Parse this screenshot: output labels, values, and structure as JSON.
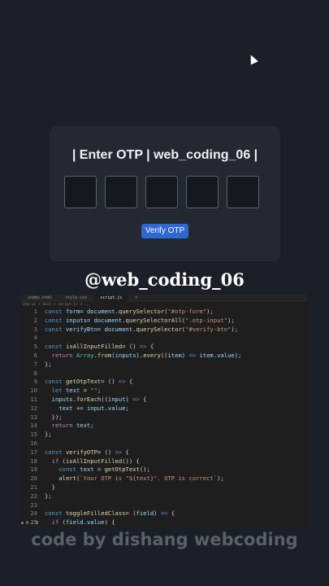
{
  "card": {
    "title": "| Enter OTP | web_coding_06 |",
    "otp_inputs": [
      "",
      "",
      "",
      "",
      ""
    ],
    "verify_label": "Verify OTP"
  },
  "handle": "@web_coding_06",
  "editor": {
    "tabs": [
      "index.html",
      "style.css",
      "script.js",
      "×"
    ],
    "breadcrumb": "otp-ui > dist > script.js > ..."
  },
  "code_lines": [
    {
      "n": "1",
      "t": [
        [
          "kw",
          "const "
        ],
        [
          "var",
          "form"
        ],
        [
          "",
          "= "
        ],
        [
          "var",
          "document"
        ],
        [
          "",
          "."
        ],
        [
          "fn",
          "querySelector"
        ],
        [
          "",
          "("
        ],
        [
          "str",
          "\"#otp-form\""
        ],
        [
          "",
          ");"
        ]
      ]
    },
    {
      "n": "2",
      "t": [
        [
          "kw",
          "const "
        ],
        [
          "var",
          "inputs"
        ],
        [
          "",
          "= "
        ],
        [
          "var",
          "document"
        ],
        [
          "",
          "."
        ],
        [
          "fn",
          "querySelectorAll"
        ],
        [
          "",
          "("
        ],
        [
          "str",
          "\".otp-input\""
        ],
        [
          "",
          ");"
        ]
      ]
    },
    {
      "n": "3",
      "t": [
        [
          "kw",
          "const "
        ],
        [
          "var",
          "verifyBtn"
        ],
        [
          "",
          "= "
        ],
        [
          "var",
          "document"
        ],
        [
          "",
          "."
        ],
        [
          "fn",
          "querySelector"
        ],
        [
          "",
          "("
        ],
        [
          "str",
          "\"#verify-btn\""
        ],
        [
          "",
          ");"
        ]
      ]
    },
    {
      "n": "4",
      "t": []
    },
    {
      "n": "5",
      "t": [
        [
          "kw",
          "const "
        ],
        [
          "fn",
          "isAllInputFilled"
        ],
        [
          "",
          "= () "
        ],
        [
          "kw",
          "=>"
        ],
        [
          "",
          " {"
        ]
      ]
    },
    {
      "n": "6",
      "t": [
        [
          "",
          "  "
        ],
        [
          "ctl",
          "return "
        ],
        [
          "cls",
          "Array"
        ],
        [
          "",
          "."
        ],
        [
          "fn",
          "from"
        ],
        [
          "",
          "("
        ],
        [
          "var",
          "inputs"
        ],
        [
          "",
          ")."
        ],
        [
          "fn",
          "every"
        ],
        [
          "",
          "(("
        ],
        [
          "var",
          "item"
        ],
        [
          "",
          ") "
        ],
        [
          "kw",
          "=>"
        ],
        [
          "",
          " "
        ],
        [
          "var",
          "item"
        ],
        [
          "",
          "."
        ],
        [
          "var",
          "value"
        ],
        [
          "",
          ");"
        ]
      ]
    },
    {
      "n": "7",
      "t": [
        [
          "",
          "};"
        ]
      ]
    },
    {
      "n": "8",
      "t": []
    },
    {
      "n": "9",
      "t": [
        [
          "kw",
          "const "
        ],
        [
          "fn",
          "getOtpText"
        ],
        [
          "",
          "= () "
        ],
        [
          "kw",
          "=>"
        ],
        [
          "",
          " {"
        ]
      ]
    },
    {
      "n": "10",
      "t": [
        [
          "",
          "  "
        ],
        [
          "kw",
          "let "
        ],
        [
          "var",
          "text"
        ],
        [
          "",
          " = "
        ],
        [
          "str",
          "\"\""
        ],
        [
          "",
          ";"
        ]
      ]
    },
    {
      "n": "11",
      "t": [
        [
          "",
          "  "
        ],
        [
          "var",
          "inputs"
        ],
        [
          "",
          "."
        ],
        [
          "fn",
          "forEach"
        ],
        [
          "",
          "(("
        ],
        [
          "var",
          "input"
        ],
        [
          "",
          ") "
        ],
        [
          "kw",
          "=>"
        ],
        [
          "",
          " {"
        ]
      ]
    },
    {
      "n": "12",
      "t": [
        [
          "",
          "    "
        ],
        [
          "var",
          "text"
        ],
        [
          "",
          " += "
        ],
        [
          "var",
          "input"
        ],
        [
          "",
          "."
        ],
        [
          "var",
          "value"
        ],
        [
          "",
          ";"
        ]
      ]
    },
    {
      "n": "13",
      "t": [
        [
          "",
          "  });"
        ]
      ]
    },
    {
      "n": "14",
      "t": [
        [
          "",
          "  "
        ],
        [
          "ctl",
          "return "
        ],
        [
          "var",
          "text"
        ],
        [
          "",
          ";"
        ]
      ]
    },
    {
      "n": "15",
      "t": [
        [
          "",
          "};"
        ]
      ]
    },
    {
      "n": "16",
      "t": []
    },
    {
      "n": "17",
      "t": [
        [
          "kw",
          "const "
        ],
        [
          "fn",
          "verifyOTP"
        ],
        [
          "",
          "= () "
        ],
        [
          "kw",
          "=>"
        ],
        [
          "",
          " {"
        ]
      ]
    },
    {
      "n": "18",
      "t": [
        [
          "",
          "  "
        ],
        [
          "ctl",
          "if "
        ],
        [
          "",
          "("
        ],
        [
          "fn",
          "isAllInputFilled"
        ],
        [
          "",
          "()) {"
        ]
      ]
    },
    {
      "n": "19",
      "t": [
        [
          "",
          "    "
        ],
        [
          "kw",
          "const "
        ],
        [
          "var",
          "text"
        ],
        [
          "",
          " = "
        ],
        [
          "fn",
          "getOtpText"
        ],
        [
          "",
          "();"
        ]
      ]
    },
    {
      "n": "20",
      "t": [
        [
          "",
          "    "
        ],
        [
          "fn",
          "alert"
        ],
        [
          "",
          "("
        ],
        [
          "str",
          "`Your OTP is \"${text}\". OTP is correct`"
        ],
        [
          "",
          ");"
        ]
      ]
    },
    {
      "n": "21",
      "t": [
        [
          "",
          "  }"
        ]
      ]
    },
    {
      "n": "22",
      "t": [
        [
          "",
          "};"
        ]
      ]
    },
    {
      "n": "23",
      "t": []
    },
    {
      "n": "24",
      "t": [
        [
          "kw",
          "const "
        ],
        [
          "fn",
          "toggleFilledClass"
        ],
        [
          "",
          "= ("
        ],
        [
          "var",
          "field"
        ],
        [
          "",
          ") "
        ],
        [
          "kw",
          "=>"
        ],
        [
          "",
          " {"
        ]
      ]
    },
    {
      "n": "25",
      "t": [
        [
          "",
          "  "
        ],
        [
          "ctl",
          "if "
        ],
        [
          "",
          "("
        ],
        [
          "var",
          "field"
        ],
        [
          "",
          "."
        ],
        [
          "var",
          "value"
        ],
        [
          "",
          ") {"
        ]
      ]
    }
  ],
  "status": "⊗ 0 ⚠ 0",
  "credit": "code by dishang webcoding",
  "colors": {
    "background": "#1b1f27",
    "card": "#232831",
    "button": "#2f67d3",
    "editor": "#1e1e1e"
  }
}
